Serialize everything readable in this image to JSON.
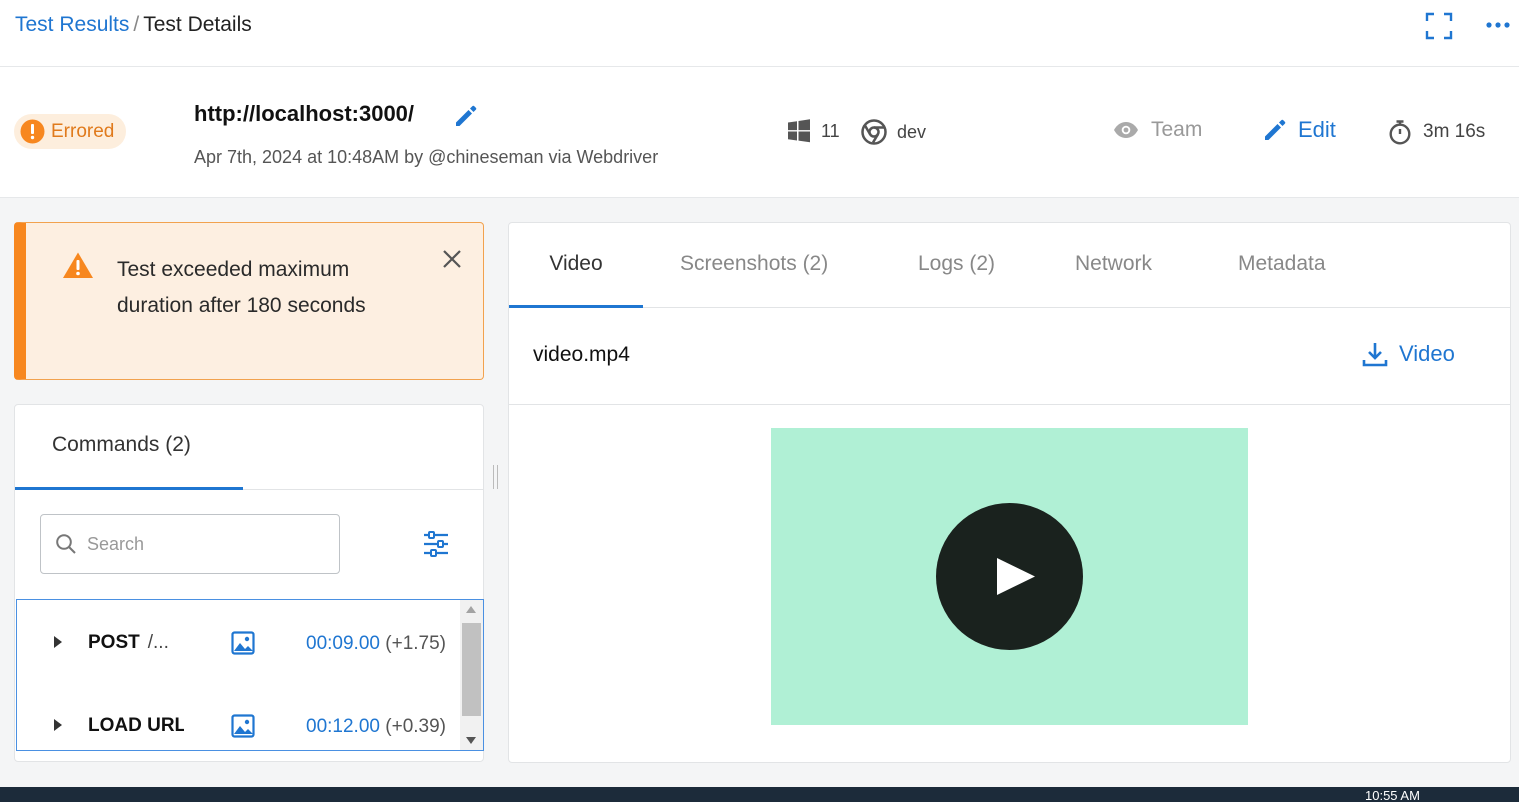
{
  "breadcrumb": {
    "parent": "Test Results",
    "separator": "/",
    "current": "Test Details"
  },
  "header": {
    "status": "Errored",
    "url": "http://localhost:3000/",
    "meta": "Apr 7th, 2024 at 10:48AM by @chineseman via Webdriver",
    "os_version": "11",
    "browser_version": "dev",
    "visibility": "Team",
    "edit_label": "Edit",
    "duration": "3m 16s"
  },
  "alert": {
    "message": "Test exceeded maximum duration after 180 seconds"
  },
  "commands": {
    "tab_label": "Commands (2)",
    "search_placeholder": "Search",
    "rows": [
      {
        "method": "POST",
        "path": "/...",
        "time": "00:09.00",
        "delta": "(+1.75)"
      },
      {
        "method": "LOAD URL",
        "path": "",
        "time": "00:12.00",
        "delta": "(+0.39)"
      }
    ]
  },
  "media": {
    "tabs": [
      "Video",
      "Screenshots (2)",
      "Logs (2)",
      "Network",
      "Metadata"
    ],
    "filename": "video.mp4",
    "download_label": "Video"
  },
  "taskbar": {
    "clock": "10:55 AM"
  },
  "colors": {
    "accent": "#1f76d1",
    "error": "#f7871f",
    "alert_bg": "#fdefe1",
    "video_bg": "#b0f0d5"
  }
}
